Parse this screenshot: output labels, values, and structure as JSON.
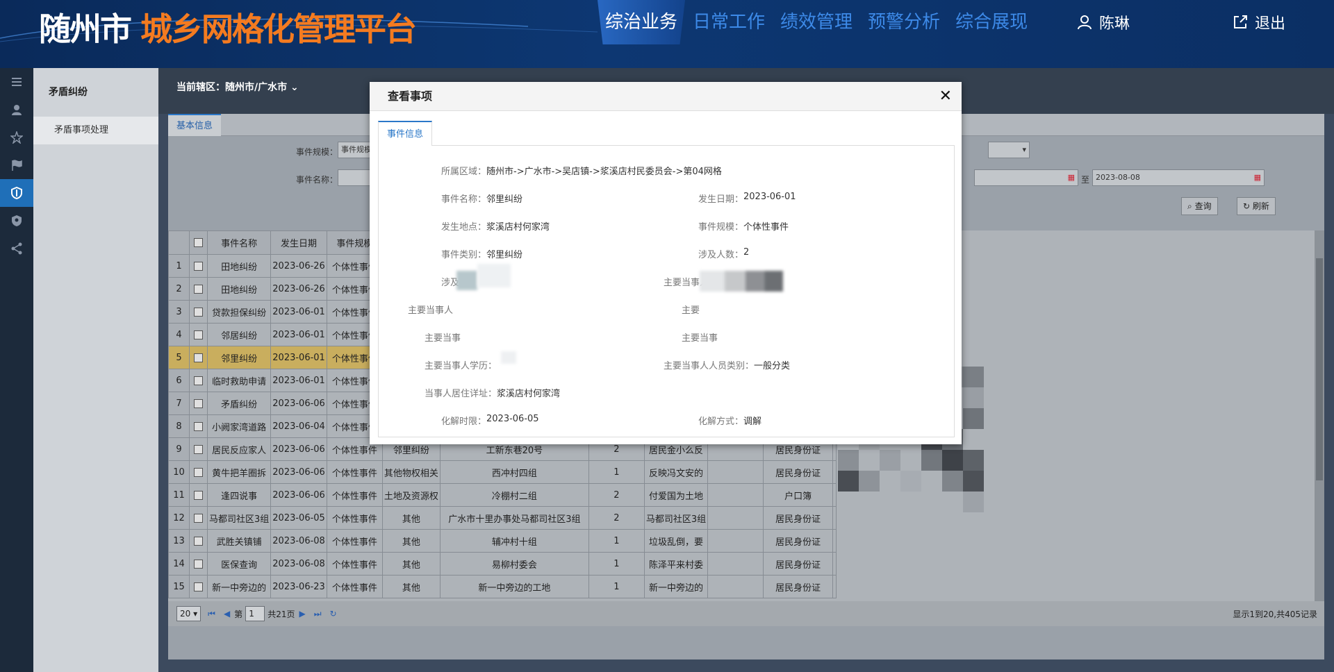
{
  "header": {
    "city": "随州市",
    "platform": "城乡网格化管理平台",
    "nav": [
      "综治业务",
      "日常工作",
      "绩效管理",
      "预警分析",
      "综合展现"
    ],
    "user": "陈琳",
    "logout": "退出"
  },
  "sidebar": {
    "section": "矛盾纠纷",
    "item": "矛盾事项处理"
  },
  "region": {
    "label": "当前辖区：",
    "value": "随州市/广水市"
  },
  "panel": {
    "tab": "基本信息",
    "filters": {
      "scale_label": "事件规模：",
      "scale_value": "事件规模",
      "name_label": "事件名称：",
      "date_to_label": "至",
      "date_to_value": "2023-08-08"
    },
    "buttons": {
      "query": "查询",
      "refresh": "刷新"
    }
  },
  "table": {
    "columns": [
      "事件名称",
      "发生日期",
      "事件规模"
    ],
    "rows": [
      {
        "no": "1",
        "name": "田地纠纷",
        "date": "2023-06-26",
        "scale": "个体性事件",
        "type": "",
        "place": "",
        "count": "",
        "desc": "",
        "id": ""
      },
      {
        "no": "2",
        "name": "田地纠纷",
        "date": "2023-06-26",
        "scale": "个体性事件",
        "type": "",
        "place": "",
        "count": "",
        "desc": "",
        "id": ""
      },
      {
        "no": "3",
        "name": "贷款担保纠纷",
        "date": "2023-06-01",
        "scale": "个体性事件",
        "type": "",
        "place": "",
        "count": "",
        "desc": "",
        "id": ""
      },
      {
        "no": "4",
        "name": "邻居纠纷",
        "date": "2023-06-01",
        "scale": "个体性事件",
        "type": "",
        "place": "",
        "count": "",
        "desc": "",
        "id": ""
      },
      {
        "no": "5",
        "name": "邻里纠纷",
        "date": "2023-06-01",
        "scale": "个体性事件",
        "type": "",
        "place": "",
        "count": "",
        "desc": "",
        "id": ""
      },
      {
        "no": "6",
        "name": "临时救助申请",
        "date": "2023-06-01",
        "scale": "个体性事件",
        "type": "",
        "place": "",
        "count": "",
        "desc": "",
        "id": ""
      },
      {
        "no": "7",
        "name": "矛盾纠纷",
        "date": "2023-06-06",
        "scale": "个体性事件",
        "type": "",
        "place": "",
        "count": "",
        "desc": "",
        "id": ""
      },
      {
        "no": "8",
        "name": "小阙家湾道路",
        "date": "2023-06-04",
        "scale": "个体性事件",
        "type": "",
        "place": "",
        "count": "",
        "desc": "",
        "id": ""
      },
      {
        "no": "9",
        "name": "居民反应家人",
        "date": "2023-06-06",
        "scale": "个体性事件",
        "type": "邻里纠纷",
        "place": "工新东巷20号",
        "count": "2",
        "desc": "居民金小么反",
        "id": "居民身份证"
      },
      {
        "no": "10",
        "name": "黄牛把羊圈拆",
        "date": "2023-06-06",
        "scale": "个体性事件",
        "type": "其他物权相关",
        "place": "西冲村四组",
        "count": "1",
        "desc": "反映冯文安的",
        "id": "居民身份证"
      },
      {
        "no": "11",
        "name": "逢四说事",
        "date": "2023-06-06",
        "scale": "个体性事件",
        "type": "土地及资源权",
        "place": "冷棚村二组",
        "count": "2",
        "desc": "付爱国为土地",
        "id": "户口簿"
      },
      {
        "no": "12",
        "name": "马都司社区3组",
        "date": "2023-06-05",
        "scale": "个体性事件",
        "type": "其他",
        "place": "广水市十里办事处马都司社区3组",
        "count": "2",
        "desc": "马都司社区3组",
        "id": "居民身份证"
      },
      {
        "no": "13",
        "name": "武胜关镇铺",
        "date": "2023-06-08",
        "scale": "个体性事件",
        "type": "其他",
        "place": "辅冲村十组",
        "count": "1",
        "desc": "垃圾乱倒，要",
        "id": "居民身份证"
      },
      {
        "no": "14",
        "name": "医保查询",
        "date": "2023-06-08",
        "scale": "个体性事件",
        "type": "其他",
        "place": "易柳村委会",
        "count": "1",
        "desc": "陈泽平来村委",
        "id": "居民身份证"
      },
      {
        "no": "15",
        "name": "新一中旁边的",
        "date": "2023-06-23",
        "scale": "个体性事件",
        "type": "其他",
        "place": "新一中旁边的工地",
        "count": "1",
        "desc": "新一中旁边的",
        "id": "居民身份证"
      }
    ]
  },
  "pager": {
    "page_size": "20",
    "page_prefix": "第",
    "page_value": "1",
    "page_total": "共21页",
    "summary": "显示1到20,共405记录"
  },
  "dialog": {
    "title": "查看事项",
    "tab": "事件信息",
    "fields": {
      "area_label": "所属区域：",
      "area_value": "随州市->广水市->吴店镇->浆溪店村民委员会->第04网格",
      "name_label": "事件名称：",
      "name_value": "邻里纠纷",
      "date_label": "发生日期：",
      "date_value": "2023-06-01",
      "place_label": "发生地点：",
      "place_value": "浆溪店村何家湾",
      "scale_label": "事件规模：",
      "scale_value": "个体性事件",
      "type_label": "事件类别：",
      "type_value": "邻里纠纷",
      "people_label": "涉及人数：",
      "people_value": "2",
      "involved_label": "涉及",
      "party_a_label": "主要当事人",
      "party_b_label": "主要当事人",
      "party_c_label": "主要",
      "party_d_label": "主要当事",
      "party_e_label": "主要当事",
      "edu_label": "主要当事人学历：",
      "edu_value": "",
      "category_label": "主要当事人人员类别：",
      "category_value": "一般分类",
      "address_label": "当事人居住详址：",
      "address_value": "浆溪店村何家湾",
      "deadline_label": "化解时限：",
      "deadline_value": "2023-06-05",
      "method_label": "化解方式：",
      "method_value": "调解"
    }
  },
  "colors": {
    "accent": "#2a77c8",
    "logo_orange": "#f47b20",
    "header_bg": "#0d3772",
    "selected_row": "#c9ae5e"
  }
}
